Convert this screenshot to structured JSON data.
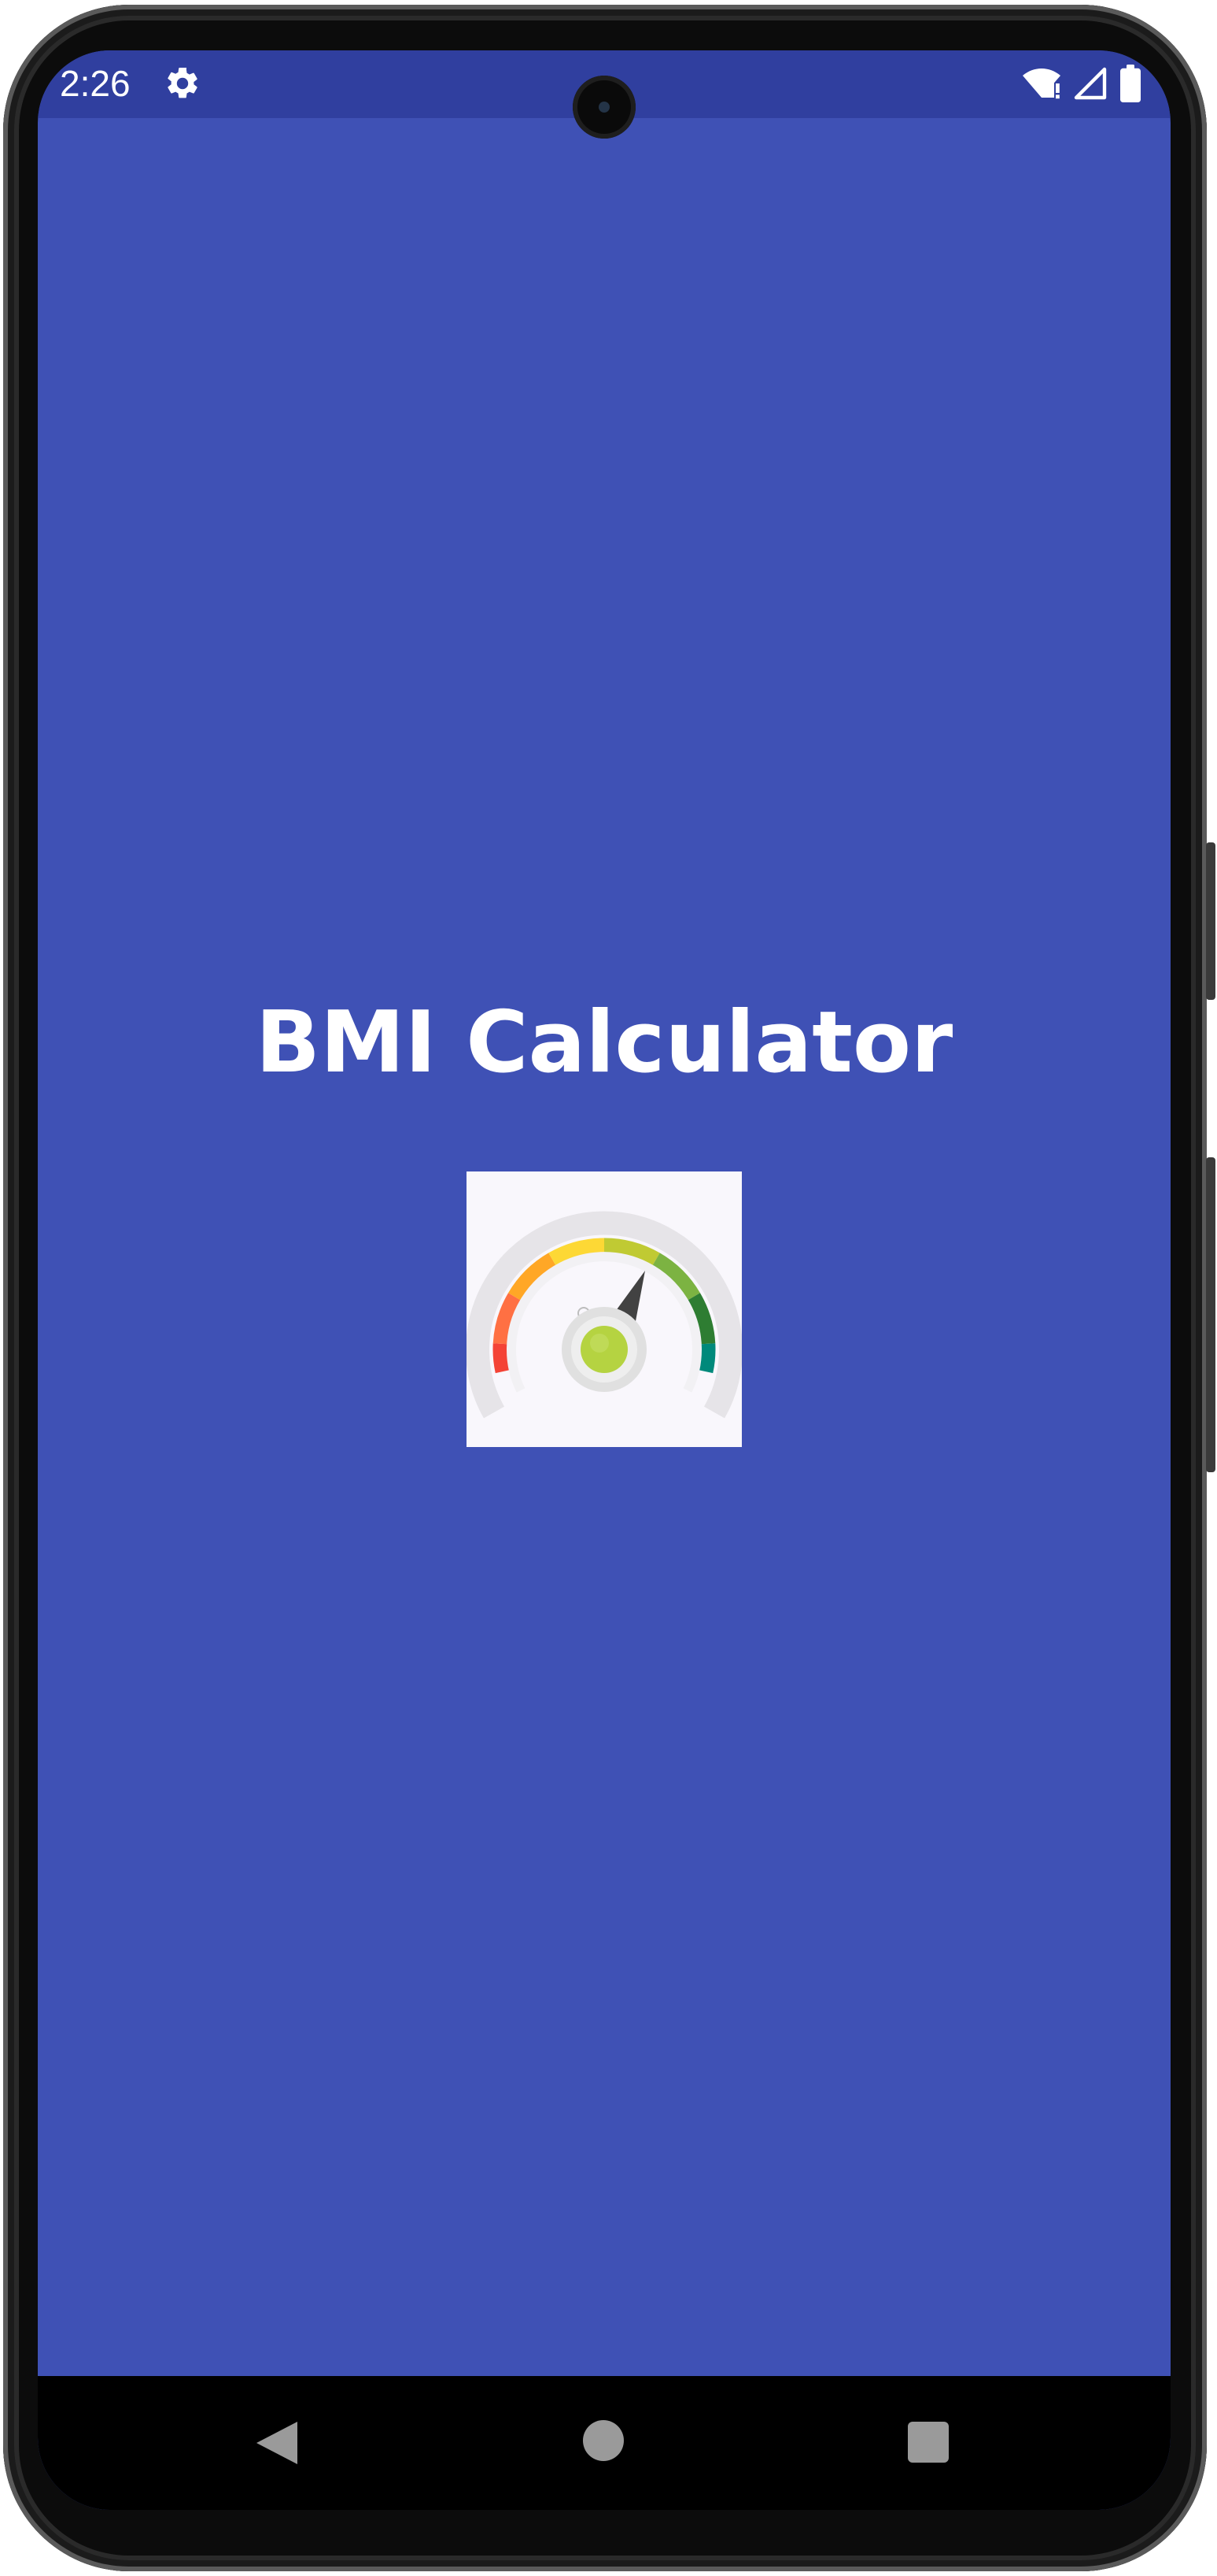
{
  "status_bar": {
    "time": "2:26",
    "icons": [
      "settings-gear-icon",
      "wifi-icon",
      "cell-signal-icon",
      "battery-icon"
    ],
    "background_color": "#303f9f"
  },
  "app": {
    "title": "BMI Calculator",
    "logo_icon": "bmi-gauge-icon",
    "background_color": "#3f51b5",
    "logo_gauge_colors": [
      "#f44336",
      "#ff9800",
      "#ffeb3b",
      "#cddc39",
      "#8bc34a",
      "#4caf50",
      "#009688"
    ]
  },
  "navigation_bar": {
    "buttons": [
      "back-icon",
      "home-icon",
      "recents-icon"
    ]
  }
}
